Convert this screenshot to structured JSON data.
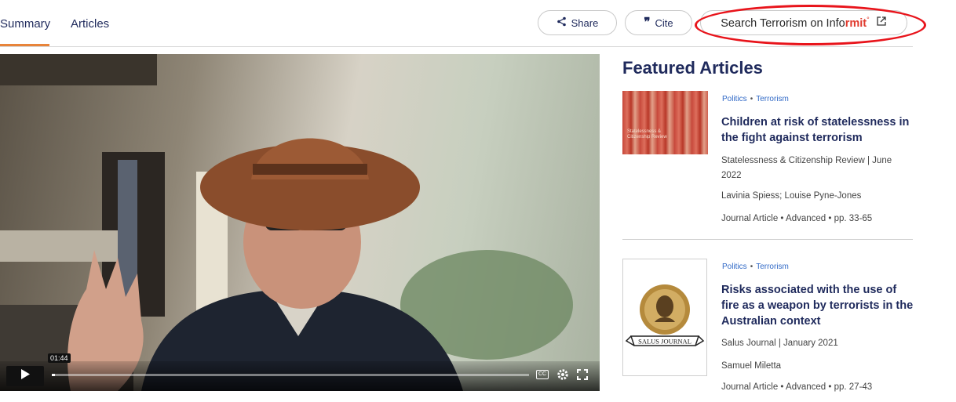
{
  "tabs": {
    "summary": "Summary",
    "articles": "Articles"
  },
  "actions": {
    "share_label": "Share",
    "cite_label": "Cite",
    "search_prefix": "Search Terrorism on ",
    "brand_a": "Info",
    "brand_b": "rmit"
  },
  "video": {
    "time_tooltip": "01:44",
    "cc_label": "CC"
  },
  "featured": {
    "heading": "Featured Articles",
    "articles": [
      {
        "tag1": "Politics",
        "tag2": "Terrorism",
        "title": "Children at risk of statelessness in the fight against terrorism",
        "source": "Statelessness & Citizenship Review | June 2022",
        "authors": "Lavinia Spiess; Louise Pyne-Jones",
        "type": "Journal Article",
        "level": "Advanced",
        "pages": "pp. 33-65",
        "thumb_text": "Statelessness & Citizenship Review"
      },
      {
        "tag1": "Politics",
        "tag2": "Terrorism",
        "title": "Risks associated with the use of fire as a weapon by terrorists in the Australian context",
        "source": "Salus Journal | January 2021",
        "authors": "Samuel Miletta",
        "type": "Journal Article",
        "level": "Advanced",
        "pages": "pp. 27-43",
        "thumb_text": "SALUS JOURNAL"
      }
    ]
  },
  "colors": {
    "accent": "#e8843a",
    "navy": "#1f2a5c",
    "link": "#2f68c6",
    "highlight": "#e8141b"
  }
}
